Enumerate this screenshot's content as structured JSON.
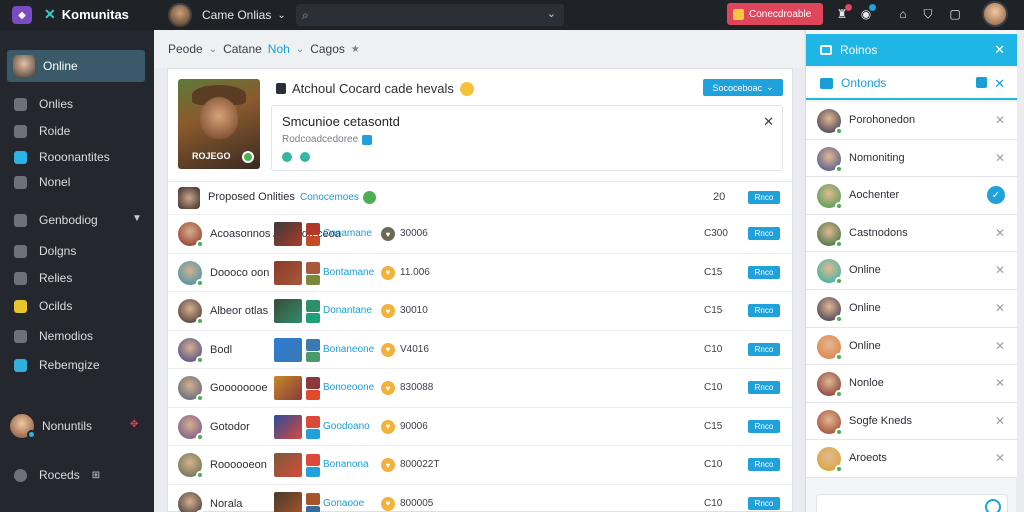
{
  "topbar": {
    "brand": "Komunitas",
    "game_select": "Came Onlias",
    "search_placeholder": "",
    "cta_label": "Conecdroable"
  },
  "sidebar": {
    "active_item": "Online",
    "items": [
      {
        "label": "Onlies",
        "icon": "user-icon"
      },
      {
        "label": "Roide",
        "icon": "lock-icon"
      },
      {
        "label": "Rooonantites",
        "icon": "chat-icon"
      },
      {
        "label": "Nonel",
        "icon": "person-icon"
      },
      {
        "label": "Genbodiog",
        "icon": "settings-icon",
        "expandable": true
      },
      {
        "label": "Dolgns",
        "icon": "game-icon"
      },
      {
        "label": "Relies",
        "icon": "message-icon"
      },
      {
        "label": "Ocilds",
        "icon": "badge-icon"
      },
      {
        "label": "Nemodios",
        "icon": "headset-icon"
      },
      {
        "label": "Rebemgize",
        "icon": "bird-icon"
      }
    ],
    "user_name": "Nonuntils",
    "footer_label": "Roceds"
  },
  "breadcrumb": {
    "items": [
      "Peode",
      "Catane",
      "Noh",
      "Cagos"
    ],
    "highlighted_index": 2
  },
  "hero": {
    "image_caption": "ROJEGO",
    "title": "Atchoul Cocard cade hevals",
    "action_label": "Sococeboac",
    "notice_title": "Smcunioe cetasontd",
    "notice_subtitle": "Rodcoadcedoree"
  },
  "list": {
    "header_label": "Proposed Onlities",
    "header_sub": "Conocemoes",
    "header_count": "20",
    "pill_label": "Rnco",
    "rows": [
      {
        "name": "Acoasonnos\nAetondo ceoa",
        "game": "Conamane",
        "value": "30006",
        "num": "C300",
        "coin": "dark"
      },
      {
        "name": "Doooco oon",
        "game": "Bontamane",
        "value": "11.006",
        "num": "C15",
        "coin": "gold"
      },
      {
        "name": "Albeor otlas",
        "game": "Donantane",
        "value": "30010",
        "num": "C15",
        "coin": "gold"
      },
      {
        "name": "Bodl",
        "game": "Bonaneone",
        "value": "V4016",
        "num": "C10",
        "coin": "gold"
      },
      {
        "name": "Goooooooe",
        "game": "Bonoeoone",
        "value": "830088",
        "num": "C10",
        "coin": "gold"
      },
      {
        "name": "Gotodor",
        "game": "Goodoano",
        "value": "90006",
        "num": "C15",
        "coin": "gold"
      },
      {
        "name": "Roooooeon",
        "game": "Bonanona",
        "value": "800022T",
        "num": "C10",
        "coin": "gold"
      },
      {
        "name": "Norala",
        "game": "Gonaooe",
        "value": "800005",
        "num": "C10",
        "coin": "gold"
      }
    ]
  },
  "right_panel": {
    "title": "Roinos",
    "subtitle": "Ontonds",
    "items": [
      {
        "name": "Porohonedon",
        "action": "close"
      },
      {
        "name": "Nomoniting",
        "action": "close"
      },
      {
        "name": "Aochenter",
        "action": "check"
      },
      {
        "name": "Castnodons",
        "action": "close"
      },
      {
        "name": "Online",
        "action": "close"
      },
      {
        "name": "Online",
        "action": "close"
      },
      {
        "name": "Online",
        "action": "close"
      },
      {
        "name": "Nonloe",
        "action": "close"
      },
      {
        "name": "Sogfe Kneds",
        "action": "close"
      },
      {
        "name": "Aroeots",
        "action": "close"
      }
    ]
  },
  "colors": {
    "accent": "#1fa1db",
    "header_cyan": "#1fb6e6",
    "cta_red": "#e0465b",
    "sidebar_bg": "#24272d",
    "topbar_bg": "#1f2227"
  }
}
